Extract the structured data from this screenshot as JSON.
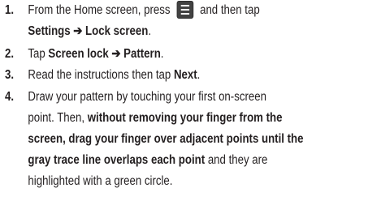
{
  "steps": [
    {
      "number": "1.",
      "line1_a": "From the Home screen, press",
      "line1_b": "and then tap",
      "line2_bold": "Settings ➔ Lock screen",
      "line2_end": ".",
      "icon": "menu-icon"
    },
    {
      "number": "2.",
      "prefix": "Tap ",
      "bold": "Screen lock ➔ Pattern",
      "suffix": "."
    },
    {
      "number": "3.",
      "prefix": "Read the instructions then tap ",
      "bold": "Next",
      "suffix": "."
    },
    {
      "number": "4.",
      "line1": "Draw your pattern by touching your first on-screen",
      "line2_a": "point. Then, ",
      "line2_bold": "without removing your finger from the",
      "line3_bold": "screen, drag your finger over adjacent points until the",
      "line4_bold": "gray trace line overlaps each point",
      "line4_rest": " and they are",
      "line5": "highlighted with a green circle."
    }
  ]
}
